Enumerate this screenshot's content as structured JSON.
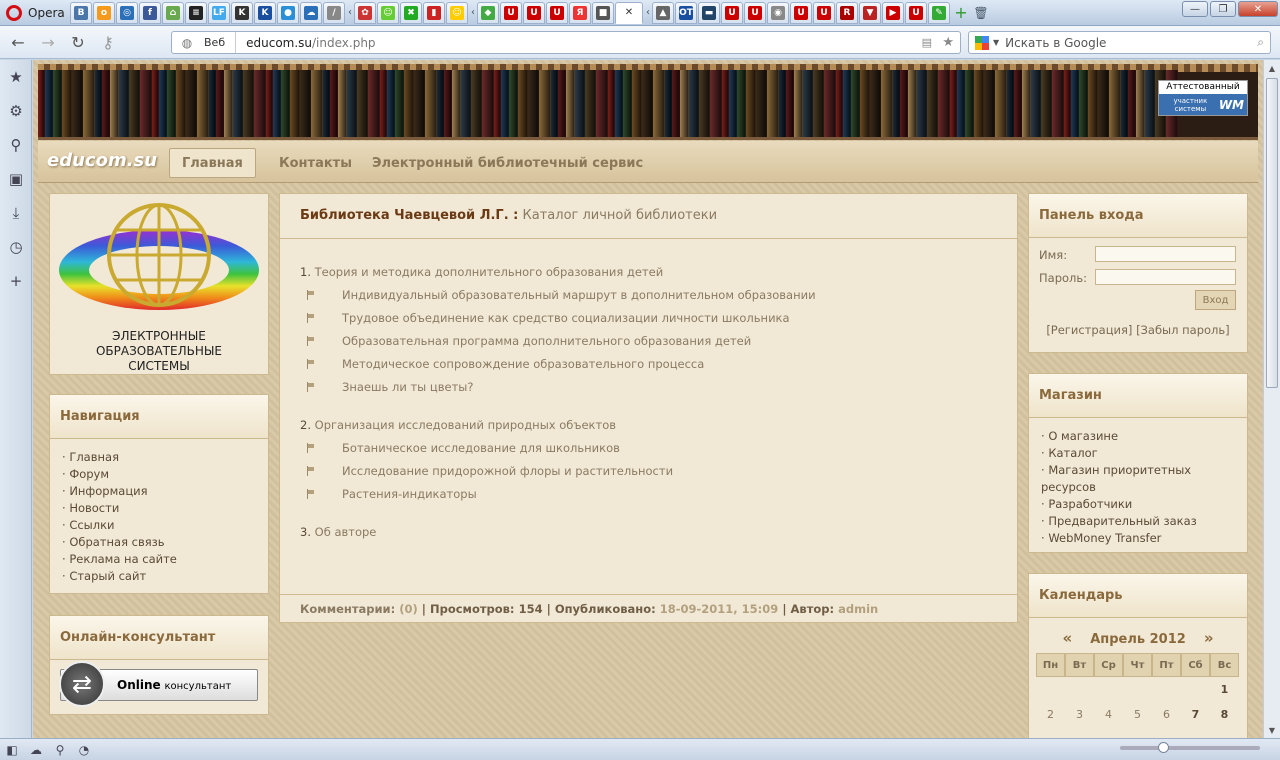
{
  "browser": {
    "opera_label": "Opera",
    "address": {
      "mode_label": "Веб",
      "url_host": "educom.su",
      "url_path": "/index.php"
    },
    "search": {
      "placeholder": "Искать в Google"
    },
    "tabs": [
      {
        "letter": "В",
        "color": "#4a76a8"
      },
      {
        "letter": "о",
        "color": "#f59a1c"
      },
      {
        "letter": "◎",
        "color": "#2a6fb8"
      },
      {
        "letter": "f",
        "color": "#3b5998"
      },
      {
        "letter": "⌂",
        "color": "#6aa84f"
      },
      {
        "letter": "≡",
        "color": "#222"
      },
      {
        "letter": "LF",
        "color": "#44aaee"
      },
      {
        "letter": "K",
        "color": "#333"
      },
      {
        "letter": "K",
        "color": "#1a4fa0"
      },
      {
        "letter": "●",
        "color": "#2b8fd8"
      },
      {
        "letter": "☁",
        "color": "#2a6fb8"
      },
      {
        "letter": "/",
        "color": "#888"
      },
      {
        "letter": "✿",
        "color": "#c33"
      },
      {
        "letter": "☺",
        "color": "#6c3"
      },
      {
        "letter": "✖",
        "color": "#2a2"
      },
      {
        "letter": "▮",
        "color": "#c22"
      },
      {
        "letter": "☺",
        "color": "#fc0"
      },
      {
        "letter": "◆",
        "color": "#4a4"
      },
      {
        "letter": "U",
        "color": "#c00"
      },
      {
        "letter": "U",
        "color": "#c00"
      },
      {
        "letter": "U",
        "color": "#c00"
      },
      {
        "letter": "Я",
        "color": "#e33"
      },
      {
        "letter": "■",
        "color": "#555"
      },
      {
        "letter": "▲",
        "color": "#666"
      },
      {
        "letter": "OT",
        "color": "#1a4fa0"
      },
      {
        "letter": "▬",
        "color": "#246"
      },
      {
        "letter": "U",
        "color": "#c00"
      },
      {
        "letter": "U",
        "color": "#c00"
      },
      {
        "letter": "◉",
        "color": "#888"
      },
      {
        "letter": "U",
        "color": "#c00"
      },
      {
        "letter": "U",
        "color": "#c00"
      },
      {
        "letter": "R",
        "color": "#a00"
      },
      {
        "letter": "▼",
        "color": "#b22"
      },
      {
        "letter": "▶",
        "color": "#c00"
      },
      {
        "letter": "U",
        "color": "#c00"
      },
      {
        "letter": "✎",
        "color": "#3a3"
      }
    ]
  },
  "site": {
    "brand": "educom.su",
    "attest_line1": "Аттестованный",
    "attest_line2": "участник системы",
    "attest_wm": "WM",
    "topnav": [
      "Главная",
      "Контакты",
      "Электронный библиотечный сервис"
    ],
    "logo_text": [
      "ЭЛЕКТРОННЫЕ",
      "ОБРАЗОВАТЕЛЬНЫЕ",
      "СИСТЕМЫ"
    ],
    "navigation": {
      "title": "Навигация",
      "items": [
        "Главная",
        "Форум",
        "Информация",
        "Новости",
        "Ссылки",
        "Обратная связь",
        "Реклама на сайте",
        "Старый сайт"
      ]
    },
    "consult": {
      "title": "Онлайн-консультант",
      "btn_bold": "Online",
      "btn_rest": "консультант"
    },
    "article": {
      "title_bold": "Библиотека Чаевцевой Л.Г. :",
      "title_rest": "Каталог личной библиотеки",
      "sections": [
        {
          "num": "1.",
          "title": "Теория и методика дополнительного образования детей",
          "items": [
            "Индивидуальный образовательный маршрут в дополнительном образовании",
            "Трудовое объединение как средство социализации личности школьника",
            "Образовательная программа дополнительного образования детей",
            "Методическое сопровождение образовательного процесса",
            "Знаешь ли ты цветы?"
          ]
        },
        {
          "num": "2.",
          "title": "Организация исследований природных объектов",
          "items": [
            "Ботаническое исследование для школьников",
            "Исследование придорожной флоры и растительности",
            "Растения-индикаторы"
          ]
        },
        {
          "num": "3.",
          "title": "Об авторе",
          "items": []
        }
      ],
      "footer": {
        "comments_label": "Комментарии:",
        "comments_val": "(0)",
        "views_label": "Просмотров:",
        "views_val": "154",
        "published_label": "Опубликовано:",
        "published_val": "18-09-2011, 15:09",
        "author_label": "Автор:",
        "author_val": "admin"
      }
    },
    "login": {
      "title": "Панель входа",
      "name_label": "Имя:",
      "pass_label": "Пароль:",
      "enter": "Вход",
      "register": "[Регистрация]",
      "forgot": "[Забыл пароль]"
    },
    "shop": {
      "title": "Магазин",
      "items": [
        "О магазине",
        "Каталог",
        "Магазин приоритетных ресурсов",
        "Разработчики",
        "Предварительный заказ",
        "WebMoney Transfer"
      ]
    },
    "calendar": {
      "title": "Календарь",
      "prev": "«",
      "next": "»",
      "month": "Апрель 2012",
      "weekdays": [
        "Пн",
        "Вт",
        "Ср",
        "Чт",
        "Пт",
        "Сб",
        "Вс"
      ],
      "row1": [
        "",
        "",
        "",
        "",
        "",
        "",
        "1"
      ],
      "row2": [
        "2",
        "3",
        "4",
        "5",
        "6",
        "7",
        "8"
      ]
    }
  }
}
